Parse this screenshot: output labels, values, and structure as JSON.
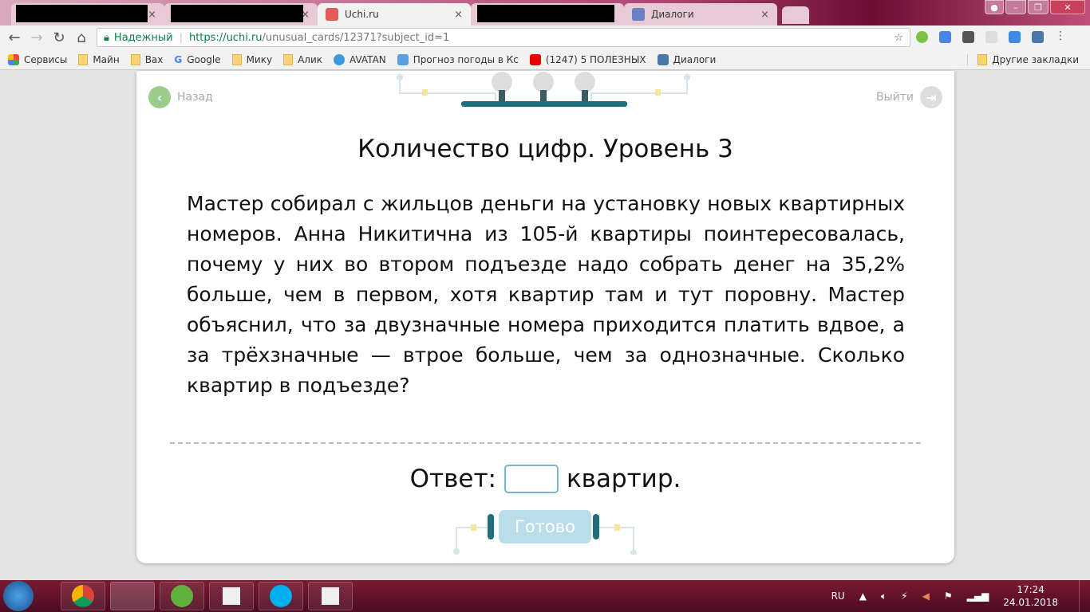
{
  "browser": {
    "tabs": [
      {
        "label": "",
        "redacted": true
      },
      {
        "label": "",
        "redacted": true
      },
      {
        "label": "Uchi.ru",
        "active": true
      },
      {
        "label": "",
        "redacted": true
      },
      {
        "label": "Диалоги"
      }
    ],
    "secure_label": "Надежный",
    "url_host": "https://uchi.ru",
    "url_path": "/unusual_cards/12371?subject_id=1",
    "bookmarks": [
      "Сервисы",
      "Майн",
      "Вах",
      "Google",
      "Мику",
      "Алик",
      "AVATAN",
      "Прогноз погоды в Кс",
      "(1247) 5 ПОЛЕЗНЫХ",
      "Диалоги"
    ],
    "other_bookmarks": "Другие закладки"
  },
  "page": {
    "back_label": "Назад",
    "exit_label": "Выйти",
    "title": "Количество цифр. Уровень 3",
    "problem": "Мастер собирал с жильцов деньги на установку новых квартирных номеров. Анна Никитична из 105-й квартиры поинтересовалась, почему у них во втором подъезде надо собрать денег на 35,2% больше, чем в первом, хотя квартир там и тут поровну. Мастер объяснил, что за двузначные номера приходится платить вдвое, а за трёхзначные — втрое больше, чем за однозначные. Сколько квартир в подъезде?",
    "answer_prefix": "Ответ:",
    "answer_suffix": "квартир.",
    "answer_value": "",
    "submit_label": "Готово"
  },
  "taskbar": {
    "lang": "RU",
    "time": "17:24",
    "date": "24.01.2018"
  },
  "colors": {
    "accent_green": "#9ccc8c",
    "submit": "#b9deea",
    "input_border": "#7ab7cf"
  }
}
